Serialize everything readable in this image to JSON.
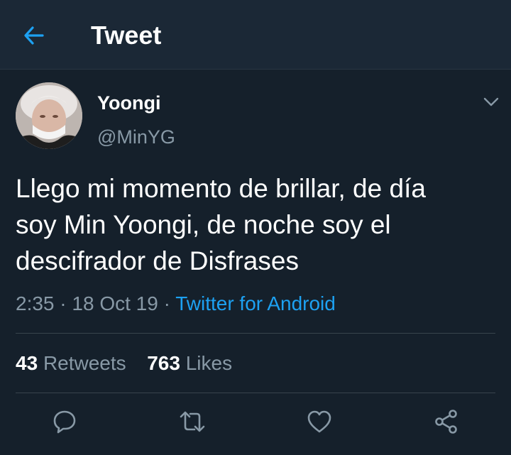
{
  "header": {
    "title": "Tweet",
    "back_icon": "arrow-left-icon",
    "accent_color": "#1da1f2",
    "background_color": "#1b2836"
  },
  "author": {
    "name": "Yoongi",
    "handle": "@MinYG",
    "avatar": "profile-avatar-photo"
  },
  "tweet": {
    "text_lines": [
      "Llego mi momento de brillar, de día",
      "soy Min Yoongi, de noche soy el",
      "descifrador de Disfrases"
    ],
    "time": "2:35",
    "separator": "·",
    "date": "18 Oct 19",
    "source": "Twitter for Android"
  },
  "stats": {
    "retweets_count": "43",
    "retweets_label": "Retweets",
    "likes_count": "763",
    "likes_label": "Likes"
  },
  "actions": {
    "reply_icon": "reply-icon",
    "retweet_icon": "retweet-icon",
    "like_icon": "heart-icon",
    "share_icon": "share-icon",
    "icon_color": "#8899a6"
  },
  "theme": {
    "page_background": "#15202b",
    "divider_color": "#38444d",
    "secondary_text": "#8899a6"
  }
}
